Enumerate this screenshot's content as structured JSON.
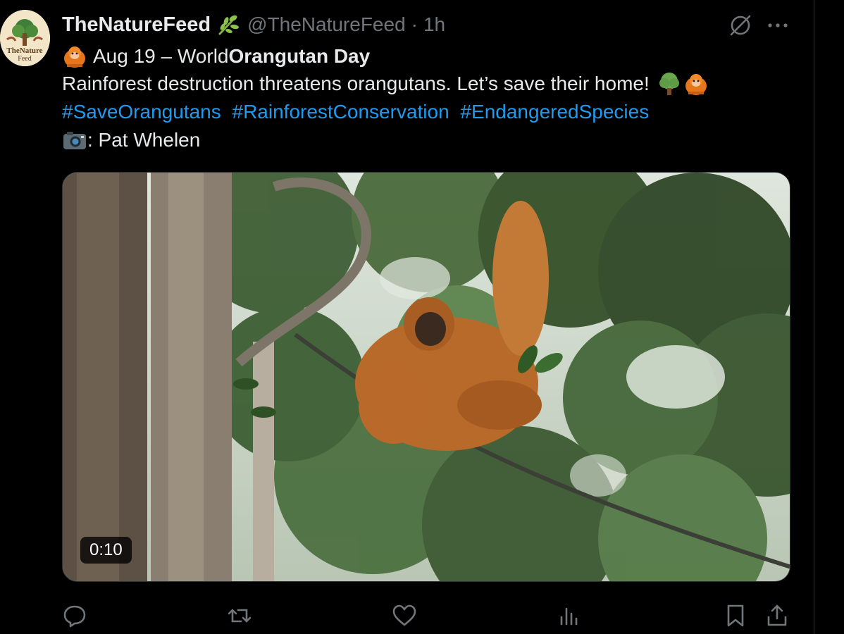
{
  "post": {
    "display_name": "TheNatureFeed",
    "handle": "@TheNatureFeed",
    "separator": "·",
    "time": "1h",
    "avatar_text": "TheNature Feed",
    "line1_prefix": "Aug 19 – World ",
    "line1_bold": "Orangutan Day",
    "line2": "Rainforest destruction threatens orangutans. Let’s save their home!",
    "hashtags": [
      "#SaveOrangutans",
      "#RainforestConservation",
      "#EndangeredSpecies"
    ],
    "credit": ": Pat Whelen",
    "video_duration": "0:10"
  },
  "colors": {
    "link": "#1d9bf0",
    "muted": "#71767b",
    "text": "#e7e9ea",
    "background": "#000000"
  },
  "icons": {
    "header": [
      "leaf-icon",
      "grok-icon",
      "more-icon"
    ],
    "inline": [
      "orangutan-emoji",
      "tree-emoji",
      "camera-emoji"
    ],
    "actions": [
      "reply-icon",
      "repost-icon",
      "like-icon",
      "views-icon",
      "bookmark-icon",
      "share-icon"
    ]
  }
}
